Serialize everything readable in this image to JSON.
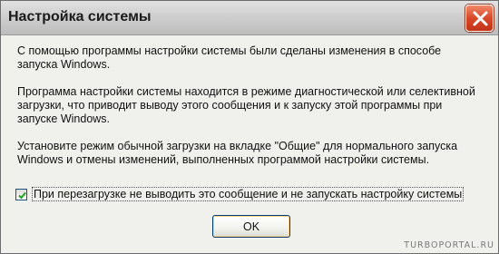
{
  "window": {
    "title": "Настройка системы"
  },
  "message": {
    "paragraphs": [
      "С помощью программы настройки системы были сделаны изменения в способе запуска Windows.",
      "Программа настройки системы находится в режиме диагностической или селективной загрузки, что приводит выводу этого сообщения и к запуску этой программы при запуске Windows.",
      "Установите режим обычной загрузки на вкладке \"Общие\" для нормального запуска Windows и отмены изменений, выполненных программой настройки системы."
    ]
  },
  "checkbox": {
    "label": "При перезагрузке не выводить это сообщение и не запускать настройку системы",
    "checked": true
  },
  "buttons": {
    "ok_label": "OK"
  },
  "watermark": "TURBOPORTAL.RU",
  "icons": {
    "close": "close-icon",
    "check": "checkmark-icon"
  },
  "colors": {
    "close_button": "#d9482a",
    "button_border": "#003c74"
  }
}
